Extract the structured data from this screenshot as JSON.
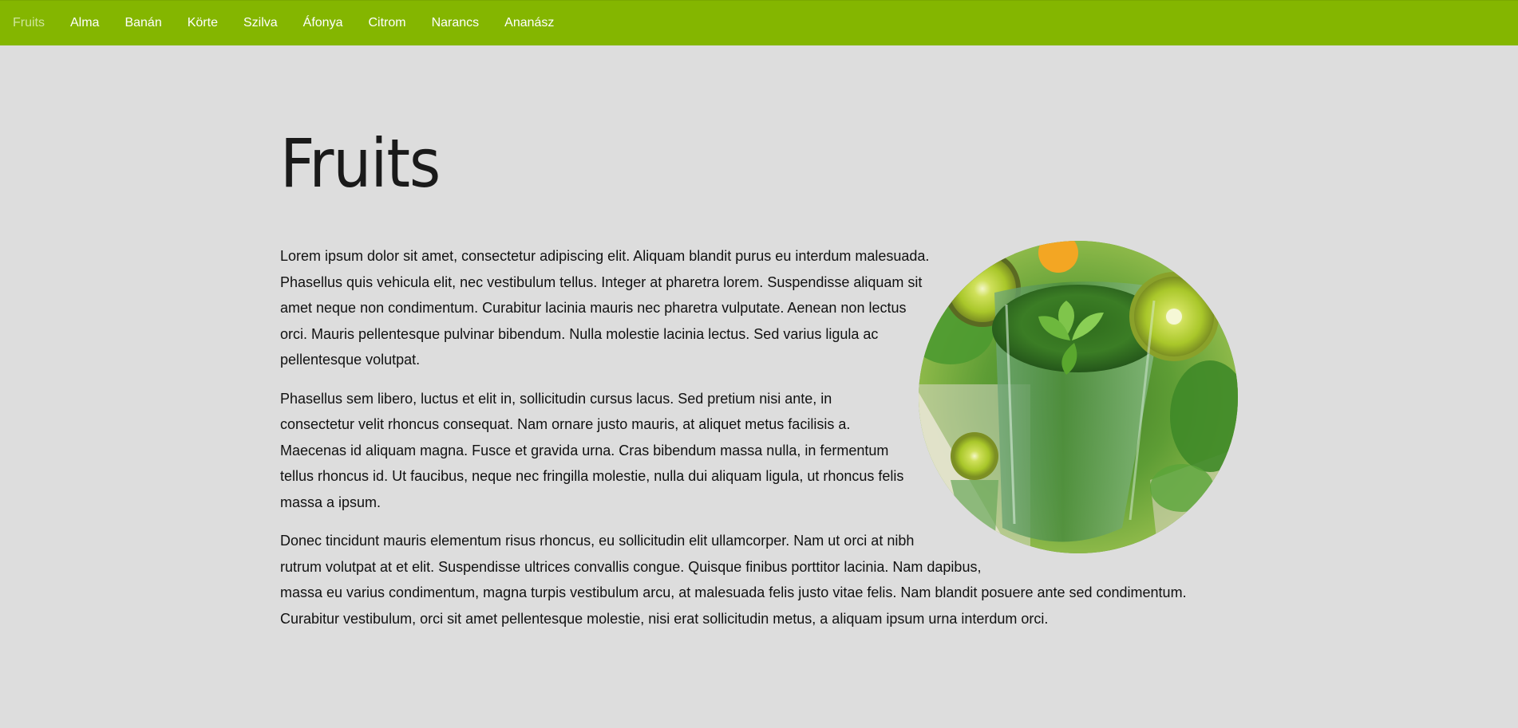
{
  "nav": {
    "items": [
      {
        "label": "Fruits",
        "active": true
      },
      {
        "label": "Alma",
        "active": false
      },
      {
        "label": "Banán",
        "active": false
      },
      {
        "label": "Körte",
        "active": false
      },
      {
        "label": "Szilva",
        "active": false
      },
      {
        "label": "Áfonya",
        "active": false
      },
      {
        "label": "Citrom",
        "active": false
      },
      {
        "label": "Narancs",
        "active": false
      },
      {
        "label": "Ananász",
        "active": false
      }
    ]
  },
  "colors": {
    "navbar": "#84b600",
    "background": "#dddddd",
    "active_nav": "#cfe59b"
  },
  "main": {
    "title": "Fruits",
    "image_icon": "green-smoothie-photo",
    "paragraphs": [
      "Lorem ipsum dolor sit amet, consectetur adipiscing elit. Aliquam blandit purus eu interdum malesuada. Phasellus quis vehicula elit, nec vestibulum tellus. Integer at pharetra lorem. Suspendisse aliquam sit amet neque non condimentum. Curabitur lacinia mauris nec pharetra vulputate. Aenean non lectus orci. Mauris pellentesque pulvinar bibendum. Nulla molestie lacinia lectus. Sed varius ligula ac pellentesque volutpat.",
      "Phasellus sem libero, luctus et elit in, sollicitudin cursus lacus. Sed pretium nisi ante, in consectetur velit rhoncus consequat. Nam ornare justo mauris, at aliquet metus facilisis a. Maecenas id aliquam magna. Fusce et gravida urna. Cras bibendum massa nulla, in fermentum tellus rhoncus id. Ut faucibus, neque nec fringilla molestie, nulla dui aliquam ligula, ut rhoncus felis massa a ipsum.",
      "Donec tincidunt mauris elementum risus rhoncus, eu sollicitudin elit ullamcorper. Nam ut orci at nibh rutrum volutpat at et elit. Suspendisse ultrices convallis congue. Quisque finibus porttitor lacinia. Nam dapibus, massa eu varius condimentum, magna turpis vestibulum arcu, at malesuada felis justo vitae felis. Nam blandit posuere ante sed condimentum. Curabitur vestibulum, orci sit amet pellentesque molestie, nisi erat sollicitudin metus, a aliquam ipsum urna interdum orci."
    ]
  }
}
